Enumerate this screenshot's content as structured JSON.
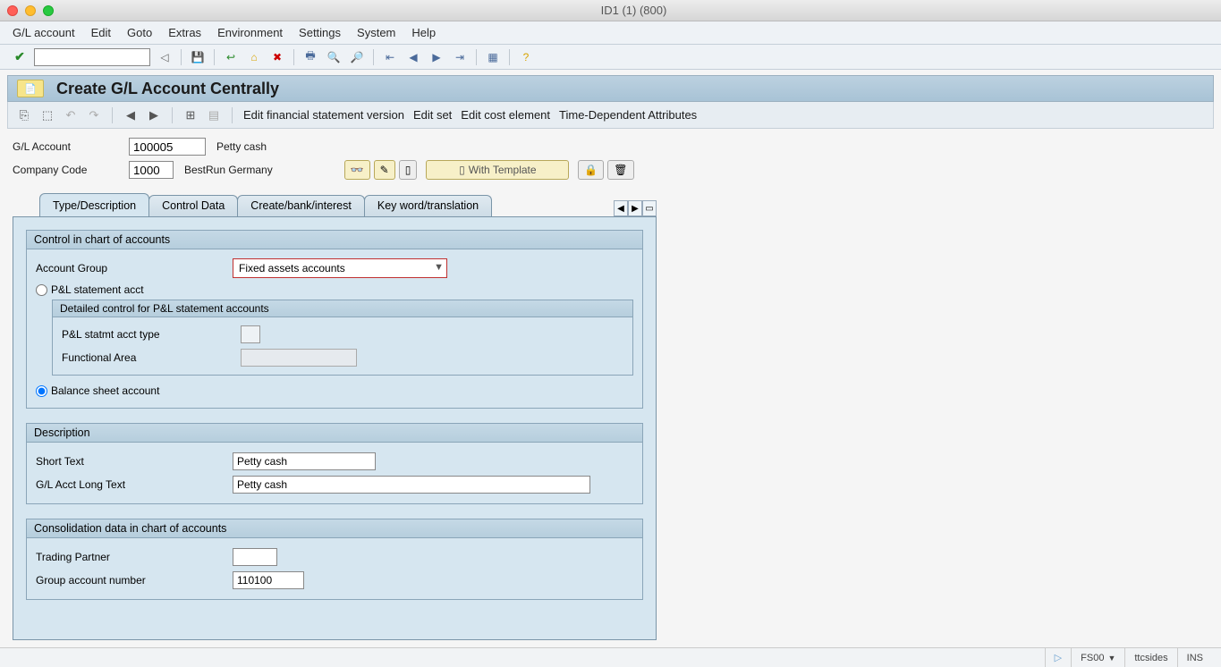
{
  "window": {
    "title": "ID1 (1) (800)"
  },
  "menu": {
    "items": [
      "G/L account",
      "Edit",
      "Goto",
      "Extras",
      "Environment",
      "Settings",
      "System",
      "Help"
    ]
  },
  "page": {
    "title": "Create G/L Account Centrally"
  },
  "subtoolbar": {
    "actions": [
      "Edit financial statement version",
      "Edit set",
      "Edit cost element",
      "Time-Dependent Attributes"
    ]
  },
  "header_fields": {
    "gl_account_label": "G/L Account",
    "gl_account_value": "100005",
    "gl_account_desc": "Petty cash",
    "company_code_label": "Company Code",
    "company_code_value": "1000",
    "company_code_desc": "BestRun Germany",
    "with_template_label": "With Template"
  },
  "tabs": {
    "items": [
      "Type/Description",
      "Control Data",
      "Create/bank/interest",
      "Key word/translation"
    ],
    "active": 0
  },
  "group1": {
    "title": "Control in chart of accounts",
    "account_group_label": "Account Group",
    "account_group_value": "Fixed assets accounts",
    "pl_radio_label": "P&L statement acct",
    "sub_title": "Detailed control for P&L statement accounts",
    "pl_type_label": "P&L statmt acct type",
    "func_area_label": "Functional Area",
    "bs_radio_label": "Balance sheet account"
  },
  "group2": {
    "title": "Description",
    "short_text_label": "Short Text",
    "short_text_value": "Petty cash",
    "long_text_label": "G/L Acct Long Text",
    "long_text_value": "Petty cash"
  },
  "group3": {
    "title": "Consolidation data in chart of accounts",
    "trading_partner_label": "Trading Partner",
    "group_acct_label": "Group account number",
    "group_acct_value": "110100"
  },
  "status": {
    "tcode": "FS00",
    "user": "ttcsides",
    "mode": "INS"
  }
}
